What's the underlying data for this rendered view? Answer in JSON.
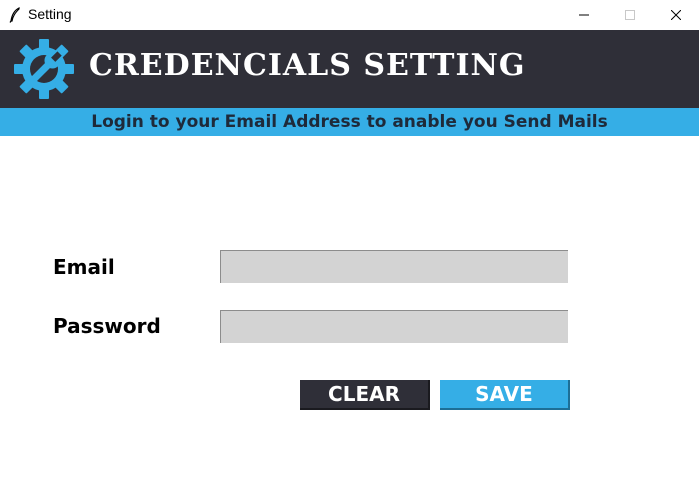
{
  "window": {
    "title": "Setting",
    "controls": [
      "minimize",
      "maximize",
      "close"
    ]
  },
  "header": {
    "title": "CREDENCIALS SETTING",
    "icon": "gear-wrench-icon"
  },
  "subtitle": "Login to your Email Address to anable you Send Mails",
  "form": {
    "email_label": "Email",
    "email_value": "",
    "password_label": "Password",
    "password_value": ""
  },
  "buttons": {
    "clear_label": "CLEAR",
    "save_label": "SAVE"
  },
  "colors": {
    "header_bg": "#2f2f38",
    "accent": "#35aee6",
    "field_bg": "#d3d3d3"
  }
}
